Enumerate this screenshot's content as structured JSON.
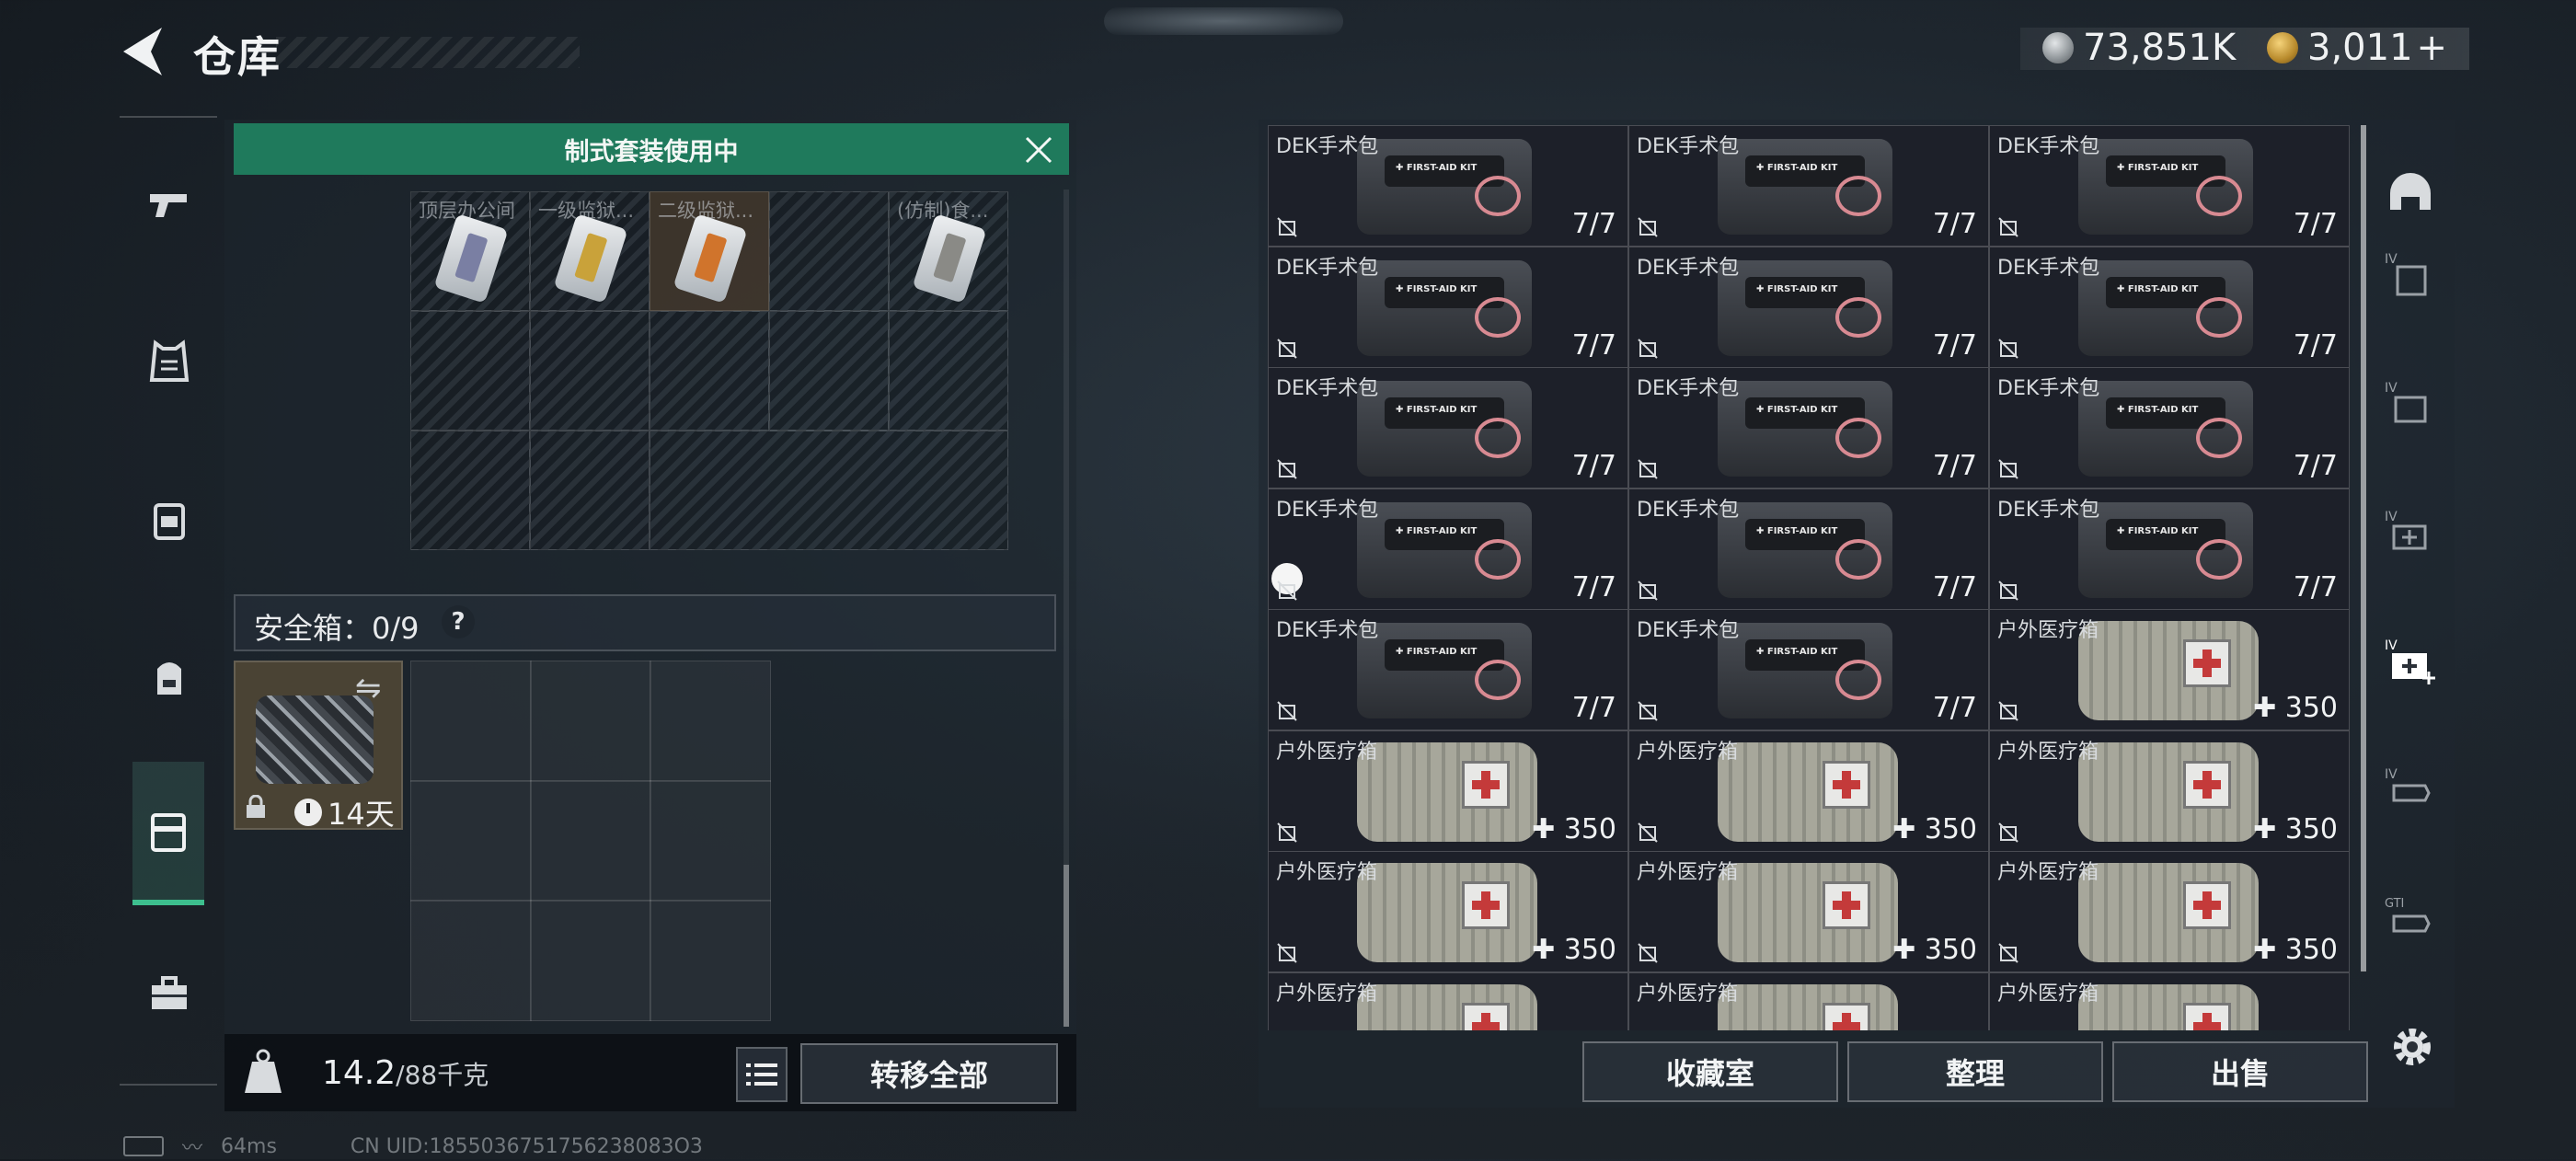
{
  "header": {
    "title": "仓库"
  },
  "currency": {
    "silver": "73,851K",
    "gold": "3,011",
    "gold_add": "+"
  },
  "loadout": {
    "banner": "制式套装使用中",
    "slots": [
      {
        "label": "顶层办公间"
      },
      {
        "label": "一级监狱..."
      },
      {
        "label": "二级监狱..."
      },
      {
        "label": ""
      },
      {
        "label": "(仿制)食..."
      }
    ]
  },
  "safebox": {
    "label": "安全箱：0/9",
    "help": "?",
    "days": "14天"
  },
  "footer_left": {
    "weight_current": "14.2",
    "weight_max": "/88千克",
    "transfer_all": "转移全部"
  },
  "status_bar": {
    "ping": "64ms",
    "uid": "CN UID:1855036751756238083O3"
  },
  "stash": {
    "items": [
      {
        "name": "DEK手术包",
        "count": "7/7",
        "kind": "bag"
      },
      {
        "name": "DEK手术包",
        "count": "7/7",
        "kind": "bag"
      },
      {
        "name": "DEK手术包",
        "count": "7/7",
        "kind": "bag"
      },
      {
        "name": "DEK手术包",
        "count": "7/7",
        "kind": "bag"
      },
      {
        "name": "DEK手术包",
        "count": "7/7",
        "kind": "bag"
      },
      {
        "name": "DEK手术包",
        "count": "7/7",
        "kind": "bag"
      },
      {
        "name": "DEK手术包",
        "count": "7/7",
        "kind": "bag"
      },
      {
        "name": "DEK手术包",
        "count": "7/7",
        "kind": "bag"
      },
      {
        "name": "DEK手术包",
        "count": "7/7",
        "kind": "bag"
      },
      {
        "name": "DEK手术包",
        "count": "7/7",
        "kind": "bag"
      },
      {
        "name": "DEK手术包",
        "count": "7/7",
        "kind": "bag"
      },
      {
        "name": "DEK手术包",
        "count": "7/7",
        "kind": "bag"
      },
      {
        "name": "DEK手术包",
        "count": "7/7",
        "kind": "bag"
      },
      {
        "name": "DEK手术包",
        "count": "7/7",
        "kind": "bag"
      },
      {
        "name": "户外医疗箱",
        "count": "✚ 350",
        "kind": "medbox"
      },
      {
        "name": "户外医疗箱",
        "count": "✚ 350",
        "kind": "medbox"
      },
      {
        "name": "户外医疗箱",
        "count": "✚ 350",
        "kind": "medbox"
      },
      {
        "name": "户外医疗箱",
        "count": "✚ 350",
        "kind": "medbox"
      },
      {
        "name": "户外医疗箱",
        "count": "✚ 350",
        "kind": "medbox"
      },
      {
        "name": "户外医疗箱",
        "count": "✚ 350",
        "kind": "medbox"
      },
      {
        "name": "户外医疗箱",
        "count": "✚ 350",
        "kind": "medbox"
      },
      {
        "name": "户外医疗箱",
        "count": "",
        "kind": "medbox"
      },
      {
        "name": "户外医疗箱",
        "count": "",
        "kind": "medbox"
      },
      {
        "name": "户外医疗箱",
        "count": "",
        "kind": "medbox"
      }
    ],
    "buttons": {
      "collection": "收藏室",
      "sort": "整理",
      "sell": "出售"
    }
  },
  "filters": {
    "labels": [
      "IV",
      "IV",
      "IV",
      "IV",
      "IV",
      "GTI"
    ]
  },
  "icons": {
    "sidebar": [
      "pistol-icon",
      "armor-vest-icon",
      "chest-rig-icon",
      "backpack-icon",
      "safebox-icon",
      "toolbox-icon"
    ],
    "filters": [
      "helmet-icon",
      "armor-filter-icon",
      "rig-filter-icon",
      "medkit-filter-icon",
      "medkit-large-filter-icon",
      "ammo-filter-icon",
      "gti-filter-icon"
    ]
  },
  "colors": {
    "accent": "#3dbf8e",
    "banner": "#1f7a5c"
  }
}
